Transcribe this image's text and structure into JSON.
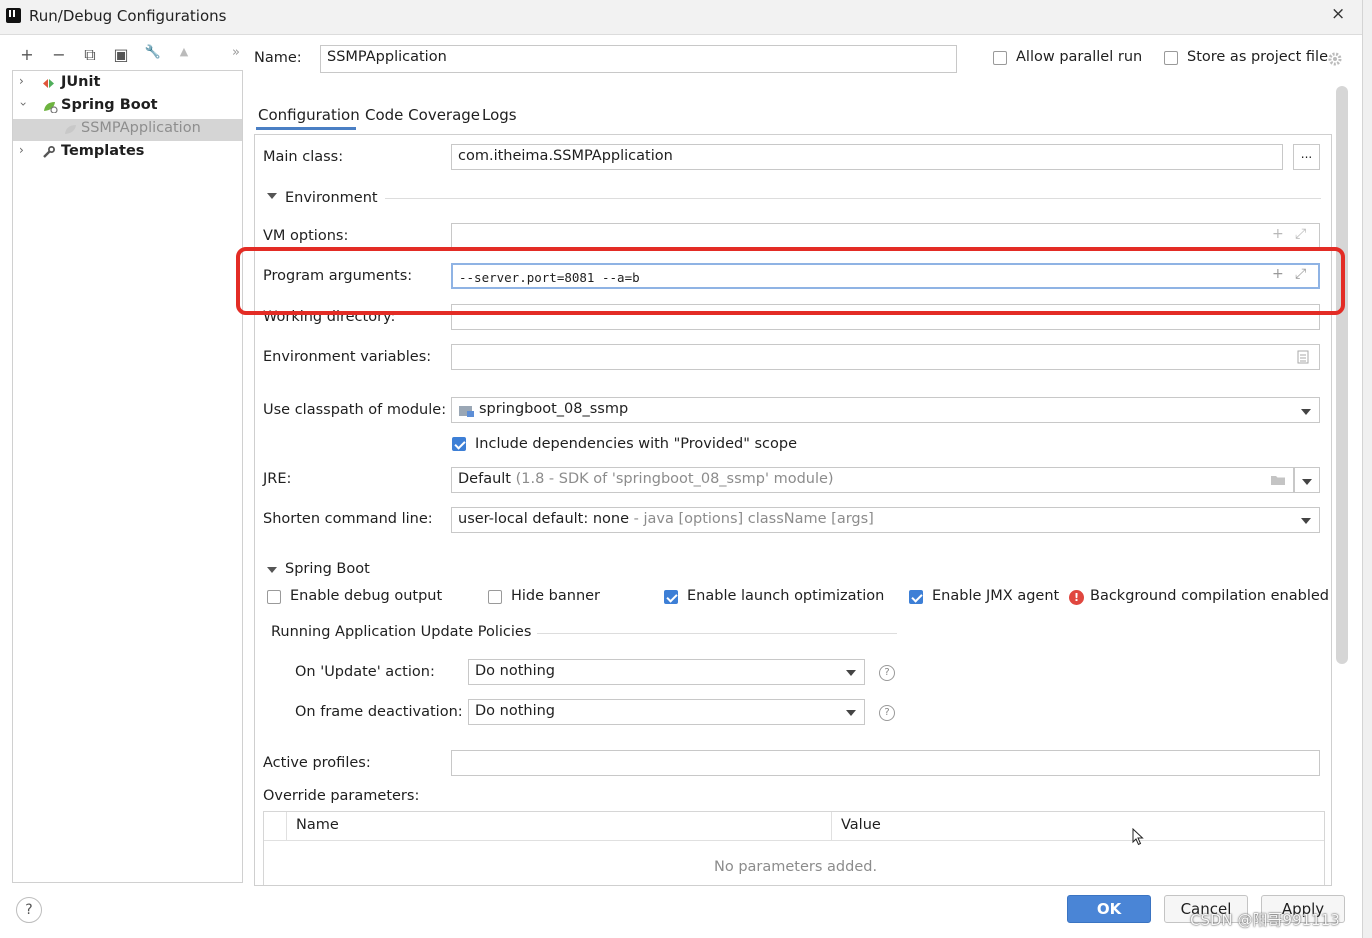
{
  "window": {
    "title": "Run/Debug Configurations",
    "close": "×"
  },
  "toolbar": {
    "add": "+",
    "remove": "−",
    "copy": "⧉",
    "save": "▣",
    "wrench": "🔧",
    "move_up": "▲",
    "expand": "»"
  },
  "tree": {
    "junit": "JUnit",
    "spring_boot": "Spring Boot",
    "ssmp_app": "SSMPApplication",
    "templates": "Templates"
  },
  "header": {
    "name_label": "Name:",
    "name_value": "SSMPApplication",
    "allow_parallel": "Allow parallel run",
    "store_as_project": "Store as project file"
  },
  "tabs": [
    {
      "label": "Configuration"
    },
    {
      "label": "Code Coverage"
    },
    {
      "label": "Logs"
    }
  ],
  "config": {
    "main_class_label": "Main class:",
    "main_class_value": "com.itheima.SSMPApplication",
    "browse": "...",
    "environment_section": "Environment",
    "vm_options_label": "VM options:",
    "program_args_label": "Program arguments:",
    "program_args_value": "--server.port=8081 --a=b",
    "working_dir_label": "Working directory:",
    "env_vars_label": "Environment variables:",
    "classpath_label": "Use classpath of module:",
    "classpath_value": "springboot_08_ssmp",
    "include_deps": "Include dependencies with \"Provided\" scope",
    "jre_label": "JRE:",
    "jre_value": "Default",
    "jre_hint": "(1.8 - SDK of 'springboot_08_ssmp' module)",
    "shorten_label": "Shorten command line:",
    "shorten_value": "user-local default: none",
    "shorten_hint": "- java [options] className [args]"
  },
  "spring_boot": {
    "section": "Spring Boot",
    "enable_debug": "Enable debug output",
    "hide_banner": "Hide banner",
    "enable_launch": "Enable launch optimization",
    "enable_jmx": "Enable JMX agent",
    "bg_compile": "Background compilation enabled",
    "policies_title": "Running Application Update Policies",
    "on_update_label": "On 'Update' action:",
    "on_update_value": "Do nothing",
    "on_frame_label": "On frame deactivation:",
    "on_frame_value": "Do nothing",
    "help": "?"
  },
  "profiles": {
    "active_label": "Active profiles:",
    "override_label": "Override parameters:",
    "col_name": "Name",
    "col_value": "Value",
    "empty": "No parameters added."
  },
  "footer": {
    "help": "?",
    "ok": "OK",
    "cancel": "Cancel",
    "apply": "Apply",
    "watermark": "CSDN @阳哥991113"
  },
  "colors": {
    "accent": "#4a85d6",
    "highlight": "#e32c25",
    "selection": "#d5d5d5"
  }
}
